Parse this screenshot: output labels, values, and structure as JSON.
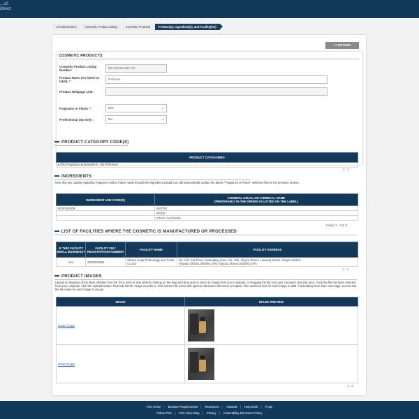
{
  "header": {
    "logo_line1": "…cf,",
    "logo_line2": "Direct"
  },
  "breadcrumbs": [
    "All Submissions",
    "Cosmetic Product Listing",
    "Cosmetic Products",
    "Product(s), Ingredient(s), and Facility(ies)"
  ],
  "return_label": "<< RETURN",
  "cosmetic_products": {
    "title": "COSMETIC PRODUCTS",
    "listing_number_label": "Cosmetic Product Listing Number:",
    "listing_number_value": "53-791108-391770",
    "product_name_label": "Product Name (As listed on label):",
    "product_name_value": "Perfume",
    "webpage_label": "Product Webpage Link:",
    "webpage_value": "",
    "fragrance_label": "Fragrance or Flavor:",
    "fragrance_value": "N/A",
    "professional_label": "Professional Use Only :",
    "professional_value": "No"
  },
  "category": {
    "title": "PRODUCT CATEGORY CODE(S)",
    "header": "PRODUCT CATEGORIES",
    "row": "(05) Fragrance preparations - (B) Perfumes",
    "pager": "1 - 1"
  },
  "ingredients": {
    "title": "INGREDIENTS",
    "note": "Note that any update regarding Fragrance and/or Flavor made through the ingredient upload tool, will automatically update the above \"Fragrance or Flavor\" selection field in the previous section.",
    "col1": "INGREDIENT UNII CODE(S)",
    "col2": "COMMON, USUAL OR CHEMICAL NAME\n(PREFERABLY IN THE ORDER AS LISTED ON THE LABEL)",
    "rows": [
      {
        "code": "9G2F9SO0R",
        "name": "WATER"
      },
      {
        "code": "",
        "name": "SPICE"
      },
      {
        "code": "",
        "name": "ETHYL ALCOHOL"
      }
    ],
    "pager": "row(s) 1 - 3 of 3"
  },
  "facilities": {
    "title": "LIST OF FACILITIES WHERE THE COSMETIC IS MANUFACTURED OR PROCESSED",
    "col1": "IS THIS FACILITY SMALL BUSINESS?",
    "col2": "FACILITY FEI / REGISTRATION NUMBER",
    "col3": "FACILITY NAME",
    "col4": "FACILITY ADDRESS",
    "row": {
      "small": "Yes",
      "fei": "3032913939",
      "name": "Shanxi Huaji Technology and Trade Co.Ltd",
      "address": "No. A97, 1st Floor, Houliejiang Lane, No. 106, Yingze Street, Liuxiang Street, Yingze District, Taiyuan,Shanxi,030000,CHN;Taiyuan,Shanxi,030000,CHN"
    },
    "pager": "1 - 1"
  },
  "images": {
    "title": "PRODUCT IMAGES",
    "note": "Upload an image(s) of the label, whether it be the front, back or side label by clicking on the drag and drop area to select an image from your computer, or dragging the file from your computer onto this area. Once the file has been selected from your computer, click the 'Upload' button. PLEASE NOTE: Image must be a .JPG format. File name with special characters will not be accepted. The maximum size for each image is 1MB. If uploading more than one image, ensure that the file name for each image is unique.",
    "col1": "IMAGE",
    "col2": "IMAGE PREVIEW",
    "rows": [
      {
        "file": "utcas (1).jpg"
      },
      {
        "file": "utcas (2).jpg"
      }
    ],
    "pager": "1 - 2"
  },
  "footer": {
    "row1": [
      "FDA Home",
      "Browser Requirements",
      "Resources",
      "Tutorials",
      "Help Desk",
      "FAQs"
    ],
    "row2": [
      "Follow FDA",
      "FDA Voice Blog",
      "Privacy",
      "Vulnerability Disclosure Policy"
    ]
  }
}
